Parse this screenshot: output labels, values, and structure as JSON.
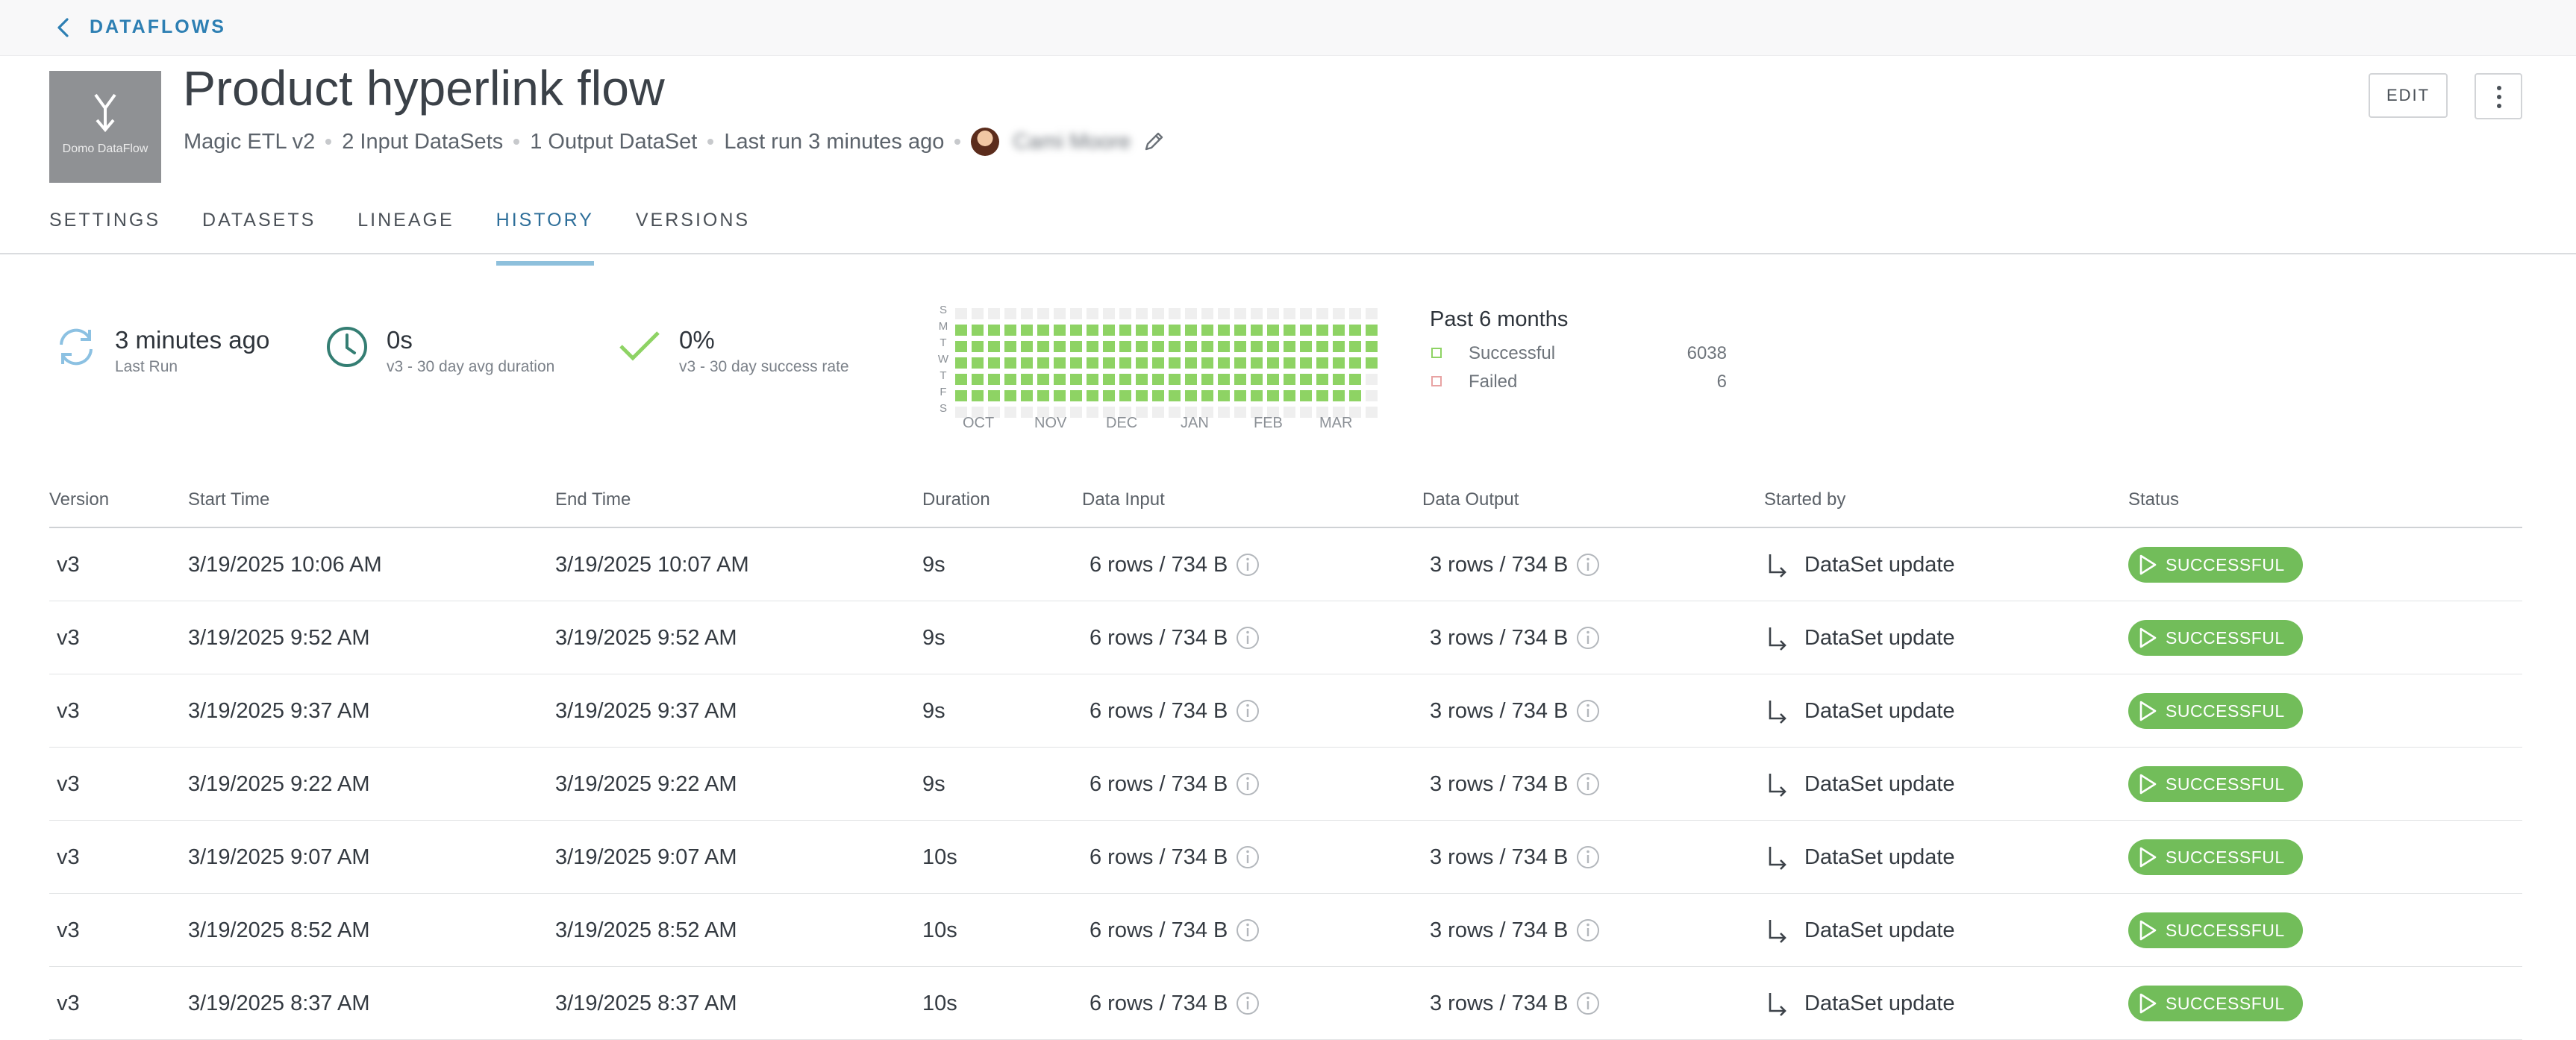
{
  "nav": {
    "back_label": "DATAFLOWS"
  },
  "header": {
    "thumbnail_label": "Domo DataFlow",
    "title": "Product hyperlink flow",
    "meta": {
      "type": "Magic ETL v2",
      "inputs": "2 Input DataSets",
      "outputs": "1 Output DataSet",
      "last_run": "Last run 3 minutes ago",
      "owner_name": "Cami Moore"
    },
    "edit_label": "EDIT"
  },
  "tabs": [
    {
      "label": "SETTINGS",
      "active": false
    },
    {
      "label": "DATASETS",
      "active": false
    },
    {
      "label": "LINEAGE",
      "active": false
    },
    {
      "label": "HISTORY",
      "active": true
    },
    {
      "label": "VERSIONS",
      "active": false
    }
  ],
  "stats": {
    "last_run": {
      "value": "3 minutes ago",
      "label": "Last Run"
    },
    "avg_duration": {
      "value": "0s",
      "label": "v3 - 30 day avg duration"
    },
    "success_rate": {
      "value": "0%",
      "label": "v3 - 30 day success rate"
    }
  },
  "heatmap": {
    "day_labels": [
      "S",
      "M",
      "T",
      "W",
      "T",
      "F",
      "S"
    ],
    "month_labels": [
      "OCT",
      "NOV",
      "DEC",
      "JAN",
      "FEB",
      "MAR"
    ],
    "weeks": 26,
    "colors": {
      "success": "#8ed364",
      "empty": "#efefef"
    },
    "success_pattern": "every weekday run successful; weekends empty; current week runs through Wednesday"
  },
  "summary": {
    "title": "Past 6 months",
    "successful_label": "Successful",
    "successful_count": "6038",
    "failed_label": "Failed",
    "failed_count": "6",
    "colors": {
      "successful": "#8ed364",
      "failed": "#e8a3a3"
    }
  },
  "table": {
    "headers": [
      "Version",
      "Start Time",
      "End Time",
      "Duration",
      "Data Input",
      "Data Output",
      "Started by",
      "Status"
    ],
    "rows": [
      {
        "version": "v3",
        "start": "3/19/2025 10:06 AM",
        "end": "3/19/2025 10:07 AM",
        "duration": "9s",
        "input": "6 rows / 734 B",
        "output": "3 rows / 734 B",
        "started_by": "DataSet update",
        "status": "SUCCESSFUL"
      },
      {
        "version": "v3",
        "start": "3/19/2025 9:52 AM",
        "end": "3/19/2025 9:52 AM",
        "duration": "9s",
        "input": "6 rows / 734 B",
        "output": "3 rows / 734 B",
        "started_by": "DataSet update",
        "status": "SUCCESSFUL"
      },
      {
        "version": "v3",
        "start": "3/19/2025 9:37 AM",
        "end": "3/19/2025 9:37 AM",
        "duration": "9s",
        "input": "6 rows / 734 B",
        "output": "3 rows / 734 B",
        "started_by": "DataSet update",
        "status": "SUCCESSFUL"
      },
      {
        "version": "v3",
        "start": "3/19/2025 9:22 AM",
        "end": "3/19/2025 9:22 AM",
        "duration": "9s",
        "input": "6 rows / 734 B",
        "output": "3 rows / 734 B",
        "started_by": "DataSet update",
        "status": "SUCCESSFUL"
      },
      {
        "version": "v3",
        "start": "3/19/2025 9:07 AM",
        "end": "3/19/2025 9:07 AM",
        "duration": "10s",
        "input": "6 rows / 734 B",
        "output": "3 rows / 734 B",
        "started_by": "DataSet update",
        "status": "SUCCESSFUL"
      },
      {
        "version": "v3",
        "start": "3/19/2025 8:52 AM",
        "end": "3/19/2025 8:52 AM",
        "duration": "10s",
        "input": "6 rows / 734 B",
        "output": "3 rows / 734 B",
        "started_by": "DataSet update",
        "status": "SUCCESSFUL"
      },
      {
        "version": "v3",
        "start": "3/19/2025 8:37 AM",
        "end": "3/19/2025 8:37 AM",
        "duration": "10s",
        "input": "6 rows / 734 B",
        "output": "3 rows / 734 B",
        "started_by": "DataSet update",
        "status": "SUCCESSFUL"
      }
    ]
  },
  "colors": {
    "accent": "#2d7fb3",
    "success_badge": "#72bd5a"
  }
}
